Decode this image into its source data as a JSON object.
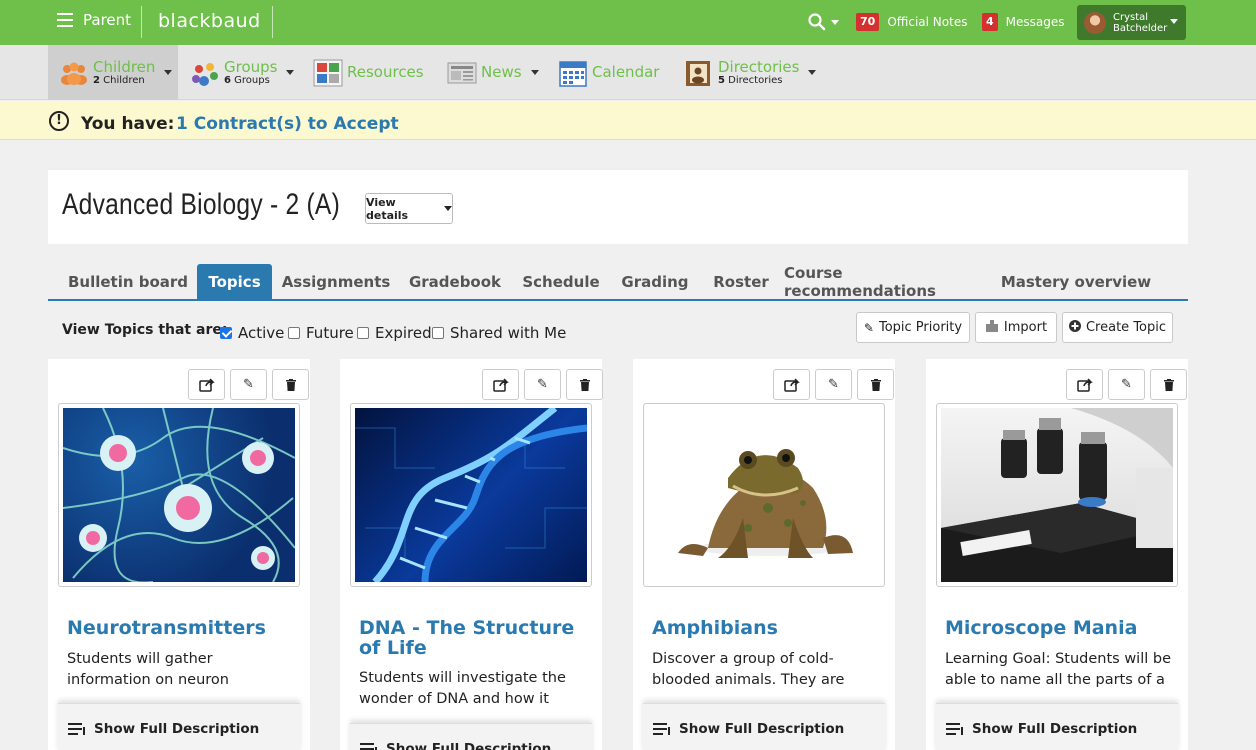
{
  "topbar": {
    "menu_label": "Parent",
    "brand": "blackbaud",
    "official_notes": {
      "count": "70",
      "label": "Official Notes"
    },
    "messages": {
      "count": "4",
      "label": "Messages"
    },
    "user": {
      "first": "Crystal",
      "last": "Batchelder"
    },
    "colors": {
      "bar": "#6ec04a",
      "badge": "#d3302f"
    }
  },
  "subnav": {
    "children": {
      "label": "Children",
      "sub_count": "2",
      "sub_label": "Children"
    },
    "groups": {
      "label": "Groups",
      "sub_count": "6",
      "sub_label": "Groups"
    },
    "resources": {
      "label": "Resources"
    },
    "news": {
      "label": "News"
    },
    "calendar": {
      "label": "Calendar"
    },
    "directories": {
      "label": "Directories",
      "sub_count": "5",
      "sub_label": "Directories"
    }
  },
  "alert": {
    "prefix": "You have:",
    "link": "1 Contract(s) to Accept",
    "icon": "exclamation-circle-icon"
  },
  "course": {
    "title": "Advanced Biology - 2 (A)",
    "view_details": "View details"
  },
  "tabs": [
    {
      "label": "Bulletin board",
      "active": false
    },
    {
      "label": "Topics",
      "active": true
    },
    {
      "label": "Assignments",
      "active": false
    },
    {
      "label": "Gradebook",
      "active": false
    },
    {
      "label": "Schedule",
      "active": false
    },
    {
      "label": "Grading",
      "active": false
    },
    {
      "label": "Roster",
      "active": false
    },
    {
      "label": "Course recommendations",
      "active": false
    },
    {
      "label": "Mastery overview",
      "active": false
    }
  ],
  "filter": {
    "label": "View Topics that are:",
    "options": [
      {
        "label": "Active",
        "checked": true
      },
      {
        "label": "Future",
        "checked": false
      },
      {
        "label": "Expired",
        "checked": false
      },
      {
        "label": "Shared with Me",
        "checked": false
      }
    ]
  },
  "actions": {
    "topic_priority": "Topic Priority",
    "import": "Import",
    "create_topic": "Create Topic"
  },
  "topics": [
    {
      "title": "Neurotransmitters",
      "description": "Students will gather information on neuron structure and action",
      "image": "neurons",
      "show_full": "Show Full Description"
    },
    {
      "title": "DNA - The Structure of Life",
      "description": "Students will investigate the wonder of DNA and how it looks",
      "image": "dna-helix",
      "show_full": "Show Full Description"
    },
    {
      "title": "Amphibians",
      "description": "Discover a group of cold-blooded animals. They are",
      "image": "frog",
      "show_full": "Show Full Description"
    },
    {
      "title": "Microscope Mania",
      "description": "Learning Goal: Students will be able to name all the parts of a",
      "image": "microscope",
      "show_full": "Show Full Description"
    }
  ]
}
